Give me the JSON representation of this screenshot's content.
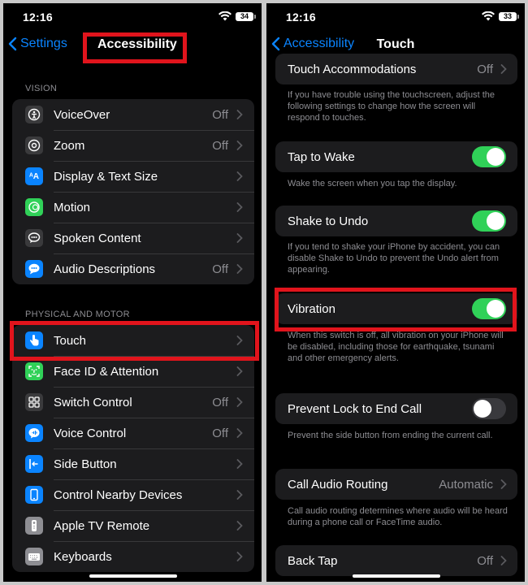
{
  "left": {
    "status": {
      "time": "12:16",
      "battery": "34"
    },
    "nav": {
      "back": "Settings",
      "title": "Accessibility"
    },
    "vision": {
      "label": "VISION",
      "items": [
        {
          "label": "VoiceOver",
          "value": "Off",
          "icon": "voiceover-icon",
          "color": "#3a3a3c"
        },
        {
          "label": "Zoom",
          "value": "Off",
          "icon": "zoom-icon",
          "color": "#3a3a3c"
        },
        {
          "label": "Display & Text Size",
          "value": "",
          "icon": "text-size-icon",
          "color": "#0a84ff"
        },
        {
          "label": "Motion",
          "value": "",
          "icon": "motion-icon",
          "color": "#30d158"
        },
        {
          "label": "Spoken Content",
          "value": "",
          "icon": "speech-bubble-icon",
          "color": "#3a3a3c"
        },
        {
          "label": "Audio Descriptions",
          "value": "Off",
          "icon": "chat-bubble-icon",
          "color": "#0a84ff"
        }
      ]
    },
    "motor": {
      "label": "PHYSICAL AND MOTOR",
      "items": [
        {
          "label": "Touch",
          "value": "",
          "icon": "hand-touch-icon",
          "color": "#0a84ff"
        },
        {
          "label": "Face ID & Attention",
          "value": "",
          "icon": "face-id-icon",
          "color": "#30d158"
        },
        {
          "label": "Switch Control",
          "value": "Off",
          "icon": "switch-grid-icon",
          "color": "#3a3a3c"
        },
        {
          "label": "Voice Control",
          "value": "Off",
          "icon": "voice-control-icon",
          "color": "#0a84ff"
        },
        {
          "label": "Side Button",
          "value": "",
          "icon": "side-button-icon",
          "color": "#0a84ff"
        },
        {
          "label": "Control Nearby Devices",
          "value": "",
          "icon": "nearby-devices-icon",
          "color": "#0a84ff"
        },
        {
          "label": "Apple TV Remote",
          "value": "",
          "icon": "tv-remote-icon",
          "color": "#8e8e93"
        },
        {
          "label": "Keyboards",
          "value": "",
          "icon": "keyboard-icon",
          "color": "#8e8e93"
        }
      ]
    }
  },
  "right": {
    "status": {
      "time": "12:16",
      "battery": "33"
    },
    "nav": {
      "back": "Accessibility",
      "title": "Touch"
    },
    "touch_accommodations": {
      "label": "Touch Accommodations",
      "value": "Off",
      "desc": "If you have trouble using the touchscreen, adjust the following settings to change how the screen will respond to touches."
    },
    "tap_to_wake": {
      "label": "Tap to Wake",
      "desc": "Wake the screen when you tap the display."
    },
    "shake_to_undo": {
      "label": "Shake to Undo",
      "desc": "If you tend to shake your iPhone by accident, you can disable Shake to Undo to prevent the Undo alert from appearing."
    },
    "vibration": {
      "label": "Vibration",
      "desc": "When this switch is off, all vibration on your iPhone will be disabled, including those for earthquake, tsunami and other emergency alerts."
    },
    "prevent_lock": {
      "label": "Prevent Lock to End Call",
      "desc": "Prevent the side button from ending the current call."
    },
    "call_audio": {
      "label": "Call Audio Routing",
      "value": "Automatic",
      "desc": "Call audio routing determines where audio will be heard during a phone call or FaceTime audio."
    },
    "back_tap": {
      "label": "Back Tap",
      "value": "Off"
    }
  }
}
